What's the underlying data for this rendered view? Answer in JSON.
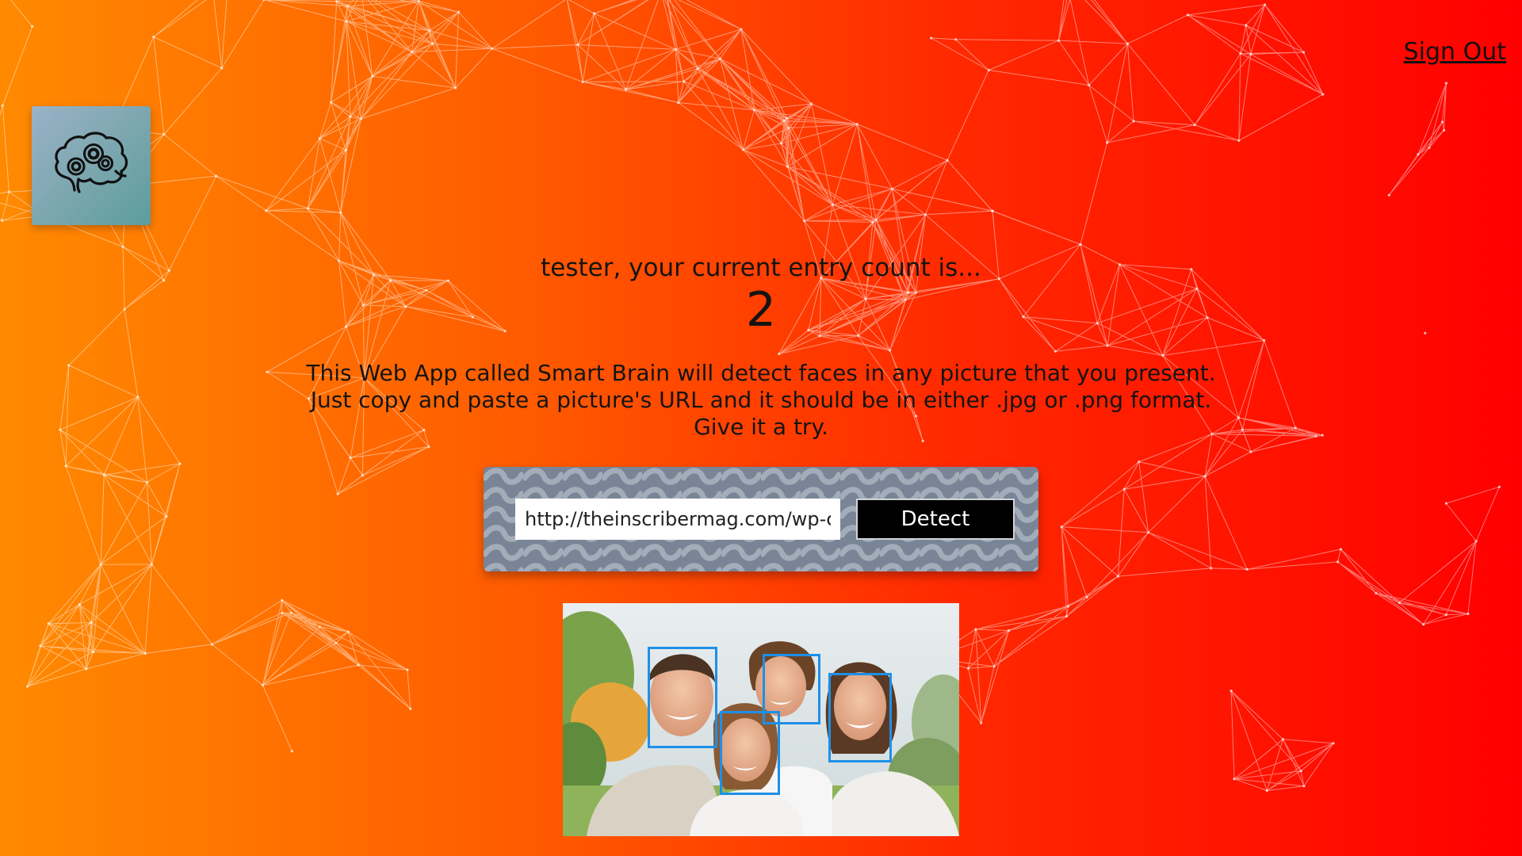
{
  "header": {
    "sign_out_label": "Sign Out",
    "logo_icon": "brain-gears-icon"
  },
  "rank": {
    "greeting": "tester, your current entry count is...",
    "count": "2"
  },
  "intro": {
    "line1": "This Web App called Smart Brain will detect faces in any picture that you present.",
    "line2": "Just copy and paste a picture's URL and it should be in either .jpg or .png format.",
    "line3": "Give it a try."
  },
  "image_link_form": {
    "url_value": "http://theinscribermag.com/wp-c",
    "detect_label": "Detect"
  },
  "face_recognition": {
    "face_count": 4
  },
  "colors": {
    "bg_gradient_start": "#ff8a00",
    "bg_gradient_end": "#ff0000",
    "face_box": "#1e8fe8",
    "panel": "#798596"
  }
}
